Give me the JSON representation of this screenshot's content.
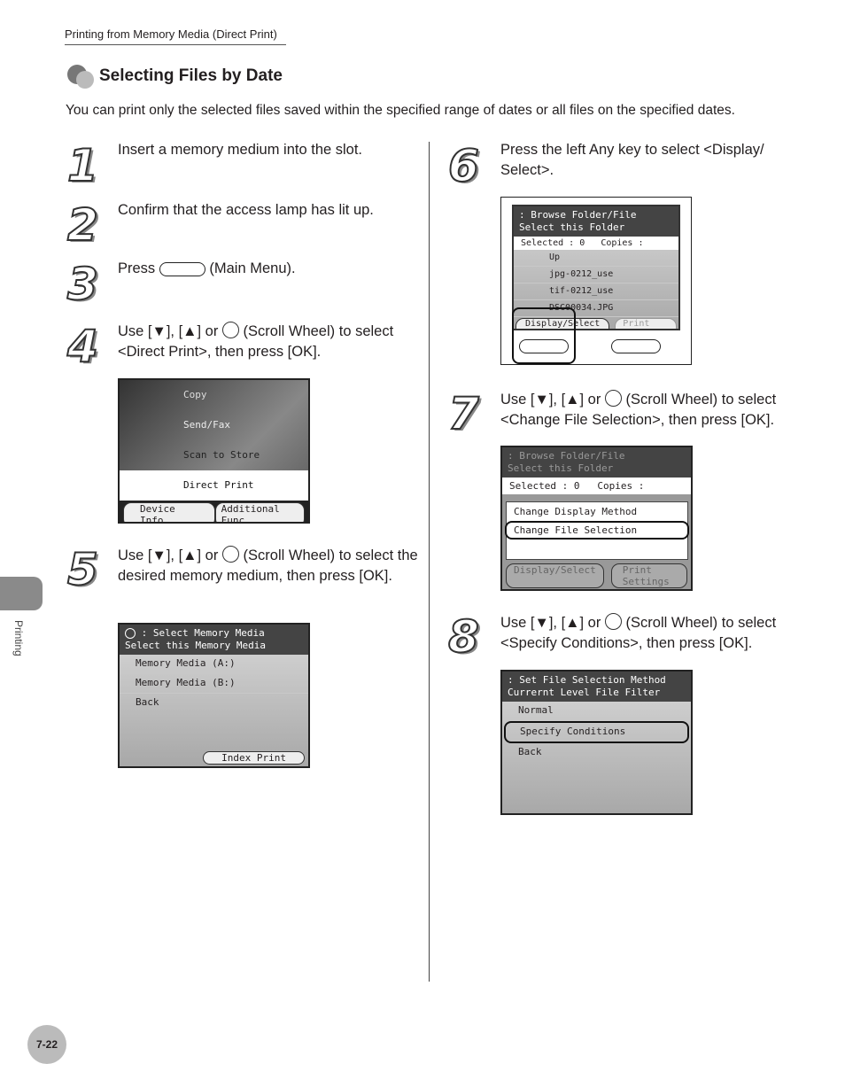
{
  "header": "Printing from Memory Media (Direct Print)",
  "section_title": "Selecting Files by Date",
  "intro": "You can print only the selected files saved within the specified range of dates or all files on the specified dates.",
  "side_tab": "Printing",
  "page_number": "7-22",
  "steps": [
    {
      "n": "1",
      "text": "Insert a memory medium into the slot."
    },
    {
      "n": "2",
      "text": "Confirm that the access lamp has lit up."
    },
    {
      "n": "3",
      "pre": "Press",
      "post": "(Main Menu)."
    },
    {
      "n": "4",
      "text": "Use [▼], [▲] or",
      "post": "(Scroll Wheel) to select <Direct Print>, then press [OK]."
    },
    {
      "n": "5",
      "text": "Use [▼], [▲] or",
      "post": "(Scroll Wheel) to select the desired memory medium, then press [OK]."
    },
    {
      "n": "6",
      "text": "Press the left Any key to select <Display/ Select>."
    },
    {
      "n": "7",
      "text": "Use [▼], [▲] or",
      "post": "(Scroll Wheel) to select <Change File Selection>, then press [OK]."
    },
    {
      "n": "8",
      "text": "Use [▼], [▲] or",
      "post": "(Scroll Wheel) to select <Specify Conditions>, then press [OK]."
    }
  ],
  "screen4": {
    "items": [
      "Copy",
      "Send/Fax",
      "Scan to Store",
      "Direct Print"
    ],
    "buttons": [
      "Device Info.",
      "Additional Func."
    ]
  },
  "screen5": {
    "title1": ": Select Memory Media",
    "title2": "Select this Memory Media",
    "items": [
      "Memory Media (A:)",
      "Memory Media (B:)",
      "Back"
    ],
    "button": "Index Print"
  },
  "screen6": {
    "title1": ": Browse Folder/File",
    "title2": "Select this Folder",
    "selected": "Selected : 0",
    "copies": "Copies    :",
    "items": [
      "Up",
      "jpg-0212_use",
      "tif-0212_use",
      "DSC00034.JPG"
    ],
    "buttons": [
      "Display/Select",
      "Print Settings"
    ]
  },
  "screen7": {
    "title1": ": Browse Folder/File",
    "title2": "Select this Folder",
    "selected": "Selected : 0",
    "copies": "Copies    :",
    "menu": [
      "Change Display Method",
      "Change File Selection"
    ],
    "buttons": [
      "Display/Select",
      "Print Settings"
    ]
  },
  "screen8": {
    "title1": ": Set File Selection Method",
    "title2": "Currernt Level File Filter",
    "items": [
      "Normal",
      "Specify Conditions",
      "Back"
    ]
  },
  "ok_icon": "OK"
}
